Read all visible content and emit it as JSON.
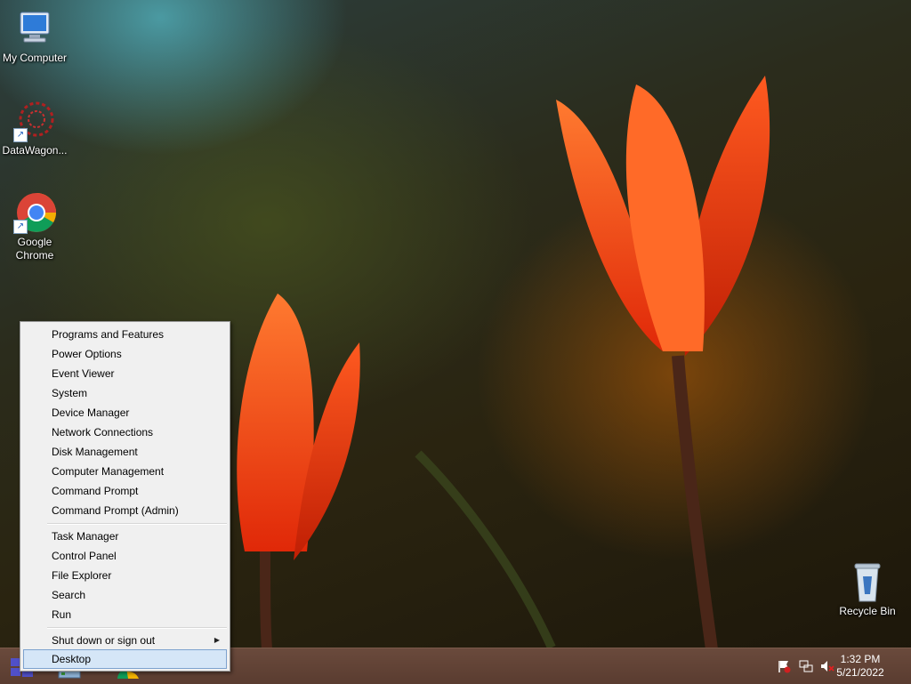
{
  "desktop": {
    "icons": [
      {
        "label": "My Computer"
      },
      {
        "label": "DataWagon..."
      },
      {
        "label": "Google Chrome"
      },
      {
        "label": "Recycle Bin"
      }
    ]
  },
  "context_menu": {
    "items": [
      {
        "label": "Programs and Features"
      },
      {
        "label": "Power Options"
      },
      {
        "label": "Event Viewer"
      },
      {
        "label": "System"
      },
      {
        "label": "Device Manager"
      },
      {
        "label": "Network Connections"
      },
      {
        "label": "Disk Management"
      },
      {
        "label": "Computer Management"
      },
      {
        "label": "Command Prompt"
      },
      {
        "label": "Command Prompt (Admin)"
      },
      {
        "label": "Task Manager"
      },
      {
        "label": "Control Panel"
      },
      {
        "label": "File Explorer"
      },
      {
        "label": "Search"
      },
      {
        "label": "Run"
      },
      {
        "label": "Shut down or sign out",
        "submenu_icon": "chevron-right-icon"
      },
      {
        "label": "Desktop",
        "selected": true
      }
    ]
  },
  "taskbar": {
    "start_icon": "windows-start-icon",
    "pinned": [
      "server-manager-icon",
      "chrome-icon"
    ],
    "tray_icons": [
      "action-center-flag-icon",
      "network-icon",
      "speaker-muted-icon"
    ]
  },
  "clock": {
    "time": "1:32 PM",
    "date": "5/21/2022"
  },
  "colors": {
    "menu_background": "#f0f0f0",
    "menu_selected": "#d5e6f7",
    "taskbar": "#5a3c30"
  }
}
